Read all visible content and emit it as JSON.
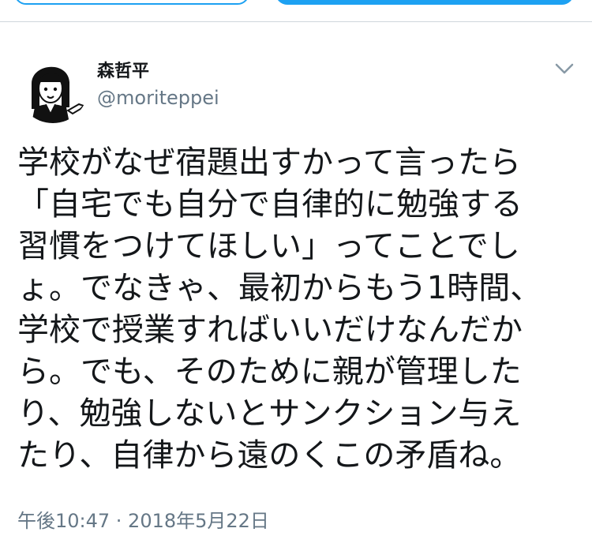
{
  "tweet": {
    "author": {
      "display_name": "森哲平",
      "handle": "@moriteppei"
    },
    "text": "学校がなぜ宿題出すかって言ったら\n「自宅でも自分で自律的に勉強する\n習慣をつけてほしい」ってことでし\nょ。でなきゃ、最初からもう1時間、\n学校で授業すればいいだけなんだか\nら。でも、そのために親が管理した\nり、勉強しないとサンクション与え\nたり、自律から遠のくこの矛盾ね。",
    "timestamp": "午後10:47 · 2018年5月22日"
  },
  "icons": {
    "menu": "chevron-down-icon",
    "avatar": "cartoon-avatar"
  },
  "colors": {
    "accent": "#1da1f2",
    "secondary_text": "#657786",
    "primary_text": "#14171a",
    "divider": "#cfd6dc"
  }
}
